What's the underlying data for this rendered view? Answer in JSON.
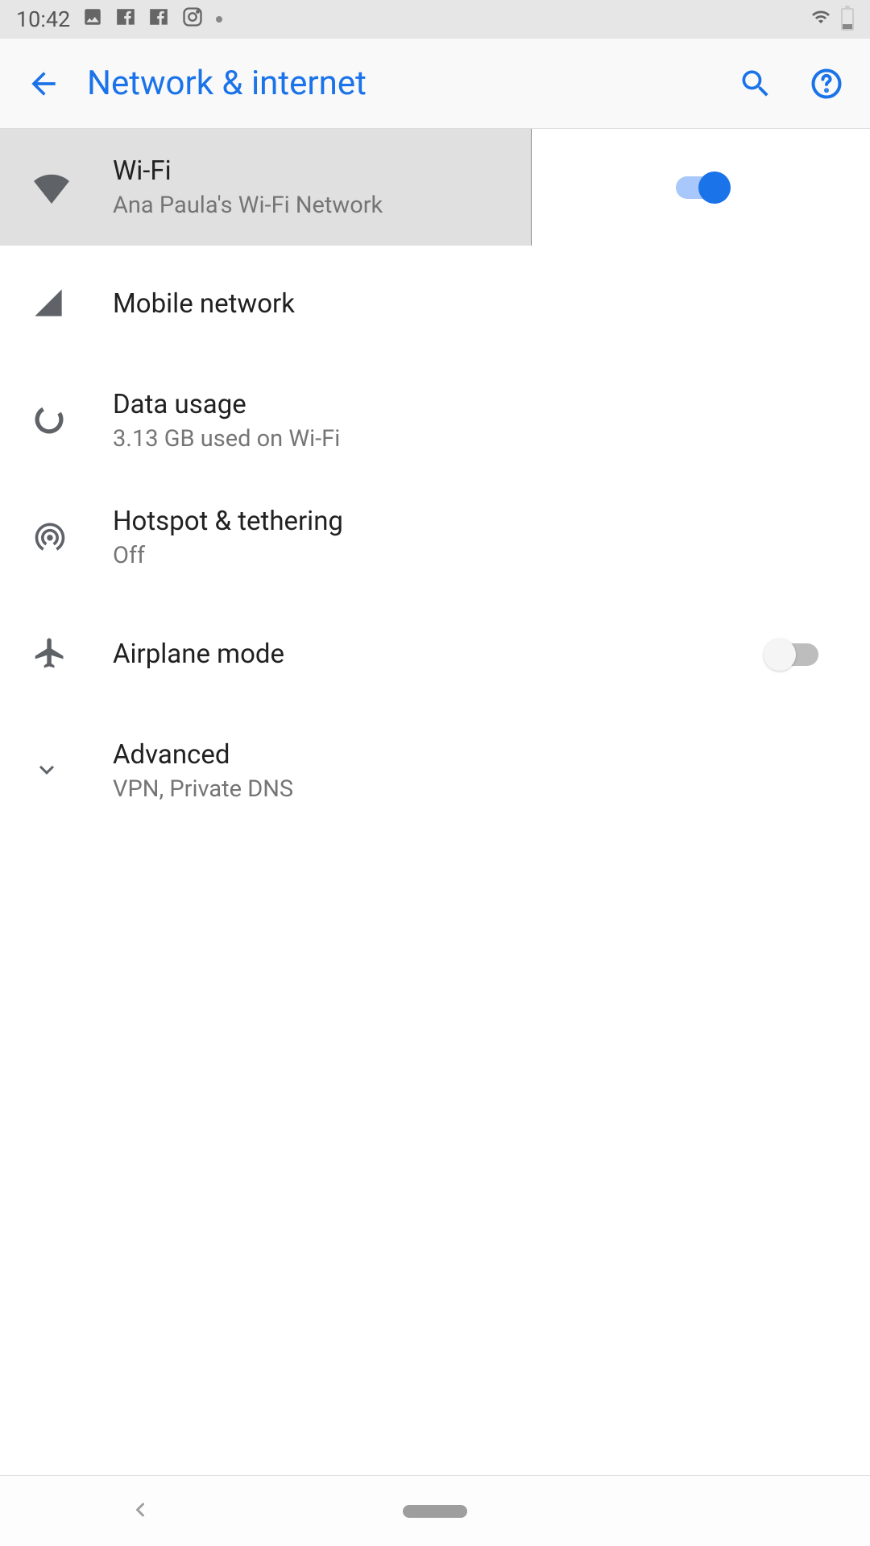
{
  "statusbar": {
    "time": "10:42"
  },
  "appbar": {
    "title": "Network & internet"
  },
  "items": {
    "wifi": {
      "title": "Wi-Fi",
      "subtitle": "Ana Paula's Wi-Fi Network",
      "toggle": true
    },
    "mobile": {
      "title": "Mobile network"
    },
    "data_usage": {
      "title": "Data usage",
      "subtitle": "3.13 GB used on Wi-Fi"
    },
    "hotspot": {
      "title": "Hotspot & tethering",
      "subtitle": "Off"
    },
    "airplane": {
      "title": "Airplane mode",
      "toggle": false
    },
    "advanced": {
      "title": "Advanced",
      "subtitle": "VPN, Private DNS"
    }
  },
  "colors": {
    "accent": "#1a73e8"
  }
}
